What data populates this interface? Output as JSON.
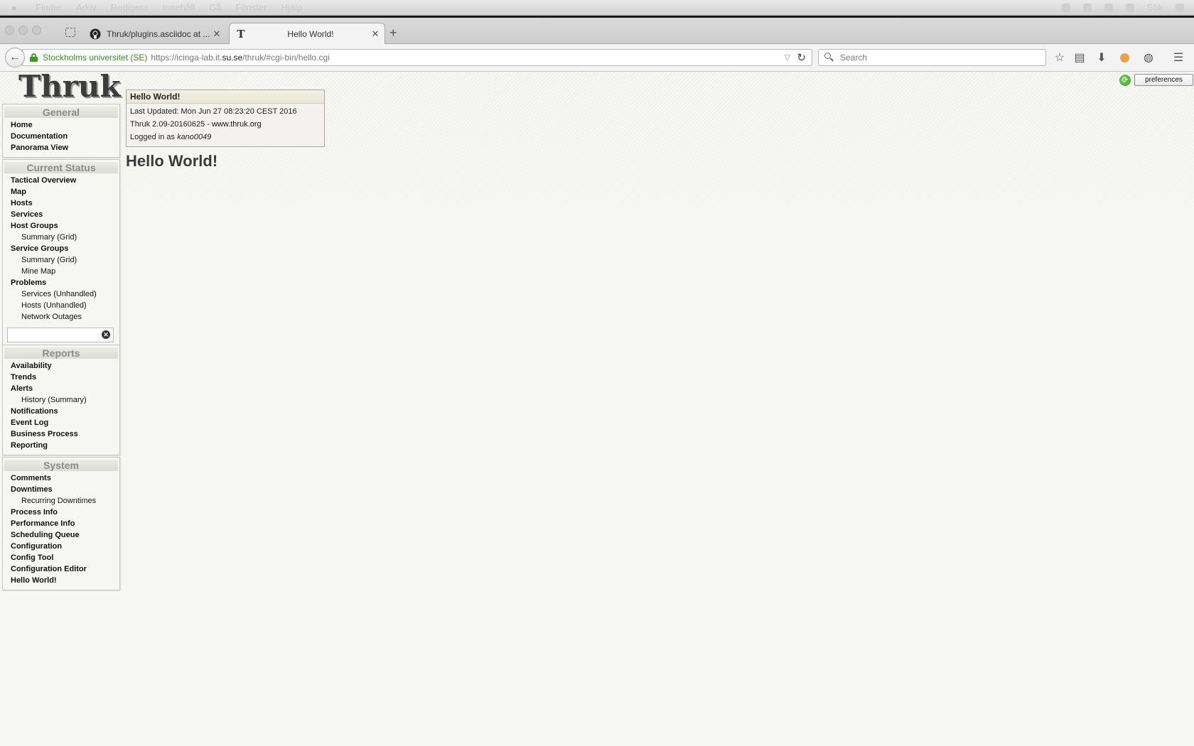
{
  "os_menubar": {
    "items": [
      "Finder",
      "Arkiv",
      "Redigera",
      "Innehåll",
      "Gå",
      "Fönster",
      "Hjälp"
    ],
    "right": [
      "Sök"
    ]
  },
  "browser": {
    "tabs": [
      {
        "title": "Thruk/plugins.asciidoc at ...",
        "icon": "github-icon"
      },
      {
        "title": "Hello World!",
        "icon": "thruk-t-icon"
      }
    ],
    "identity": "Stockholms universitet (SE)",
    "url_prefix": "https://icinga-lab.it.",
    "url_domain": "su.se",
    "url_suffix": "/thruk/#cgi-bin/hello.cgi",
    "search_placeholder": "Search"
  },
  "thruk": {
    "logo": "Thruk",
    "preferences_label": "preferences",
    "sections": [
      {
        "title": "General",
        "items": [
          {
            "label": "Home",
            "level": "top"
          },
          {
            "label": "Documentation",
            "level": "top"
          },
          {
            "label": "Panorama View",
            "level": "top"
          }
        ]
      },
      {
        "title": "Current Status",
        "items": [
          {
            "label": "Tactical Overview",
            "level": "top"
          },
          {
            "label": "Map",
            "level": "top"
          },
          {
            "label": "Hosts",
            "level": "top"
          },
          {
            "label": "Services",
            "level": "top"
          },
          {
            "label": "Host Groups",
            "level": "top"
          },
          {
            "label": "Summary (Grid)",
            "level": "sub"
          },
          {
            "label": "Service Groups",
            "level": "top"
          },
          {
            "label": "Summary (Grid)",
            "level": "sub"
          },
          {
            "label": "Mine Map",
            "level": "sub"
          },
          {
            "label": "Problems",
            "level": "top"
          },
          {
            "label": "Services (Unhandled)",
            "level": "sub"
          },
          {
            "label": "Hosts (Unhandled)",
            "level": "sub"
          },
          {
            "label": "Network Outages",
            "level": "sub"
          }
        ]
      },
      {
        "title": "Reports",
        "items": [
          {
            "label": "Availability",
            "level": "top"
          },
          {
            "label": "Trends",
            "level": "top"
          },
          {
            "label": "Alerts",
            "level": "top"
          },
          {
            "label": "History (Summary)",
            "level": "sub"
          },
          {
            "label": "Notifications",
            "level": "top"
          },
          {
            "label": "Event Log",
            "level": "top"
          },
          {
            "label": "Business Process",
            "level": "top"
          },
          {
            "label": "Reporting",
            "level": "top"
          }
        ]
      },
      {
        "title": "System",
        "items": [
          {
            "label": "Comments",
            "level": "top"
          },
          {
            "label": "Downtimes",
            "level": "top"
          },
          {
            "label": "Recurring Downtimes",
            "level": "sub"
          },
          {
            "label": "Process Info",
            "level": "top"
          },
          {
            "label": "Performance Info",
            "level": "top"
          },
          {
            "label": "Scheduling Queue",
            "level": "top"
          },
          {
            "label": "Configuration",
            "level": "top"
          },
          {
            "label": "Config Tool",
            "level": "top"
          },
          {
            "label": "Configuration Editor",
            "level": "top"
          },
          {
            "label": "Hello World!",
            "level": "top"
          }
        ]
      }
    ],
    "infobox": {
      "title": "Hello World!",
      "last_updated": "Last Updated: Mon Jun 27 08:23:20 CEST 2016",
      "version_prefix": "Thruk 2.09-20160625 - ",
      "version_link": "www.thruk.org",
      "logged_in_prefix": "Logged in as ",
      "user": "kano0049"
    },
    "page_title": "Hello World!"
  }
}
